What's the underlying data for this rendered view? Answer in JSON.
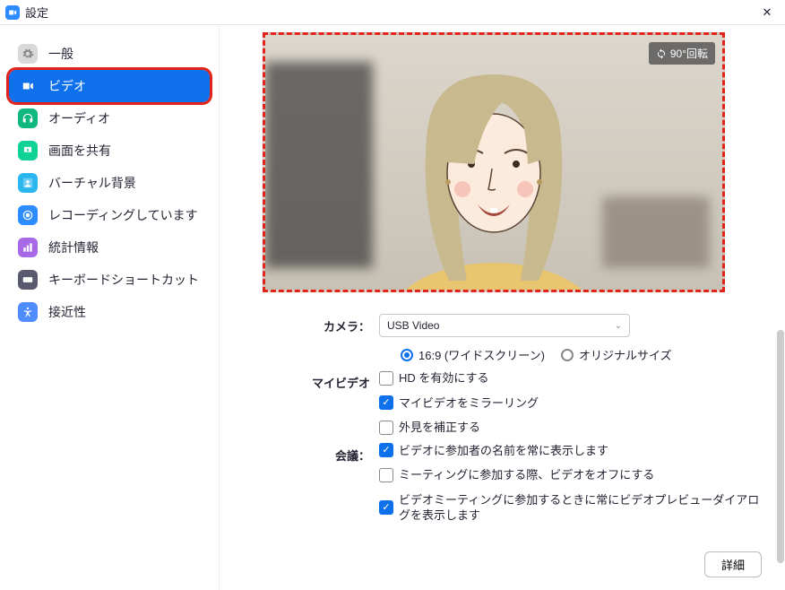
{
  "window": {
    "title": "設定",
    "rotate_label": "90°回転"
  },
  "sidebar": {
    "items": [
      {
        "label": "一般",
        "icon": "gear",
        "icon_bg": "#D9D9D9",
        "icon_fg": "#888",
        "active": false
      },
      {
        "label": "ビデオ",
        "icon": "video",
        "icon_bg": "#FFFFFF",
        "icon_fg": "#0E71EB",
        "active": true,
        "highlighted": true
      },
      {
        "label": "オーディオ",
        "icon": "headphones",
        "icon_bg": "#10B880",
        "icon_fg": "#fff",
        "active": false
      },
      {
        "label": "画面を共有",
        "icon": "share",
        "icon_bg": "#0ED296",
        "icon_fg": "#fff",
        "active": false
      },
      {
        "label": "バーチャル背景",
        "icon": "person-bg",
        "icon_bg": "#2BB6EF",
        "icon_fg": "#fff",
        "active": false
      },
      {
        "label": "レコーディングしています",
        "icon": "record",
        "icon_bg": "#2D8CFF",
        "icon_fg": "#fff",
        "active": false
      },
      {
        "label": "統計情報",
        "icon": "stats",
        "icon_bg": "#A869E6",
        "icon_fg": "#fff",
        "active": false
      },
      {
        "label": "キーボードショートカット",
        "icon": "keyboard",
        "icon_bg": "#5A5A6E",
        "icon_fg": "#fff",
        "active": false
      },
      {
        "label": "接近性",
        "icon": "accessibility",
        "icon_bg": "#4E8CFF",
        "icon_fg": "#fff",
        "active": false
      }
    ]
  },
  "video": {
    "camera_label": "カメラ：",
    "camera_value": "USB Video",
    "aspect": {
      "opt_widescreen": "16:9 (ワイドスクリーン)",
      "opt_original": "オリジナルサイズ",
      "selected": "widescreen"
    },
    "myvideo_label": "マイビデオ",
    "myvideo_options": [
      {
        "label": "HD を有効にする",
        "checked": false
      },
      {
        "label": "マイビデオをミラーリング",
        "checked": true
      },
      {
        "label": "外見を補正する",
        "checked": false
      }
    ],
    "meeting_label": "会議：",
    "meeting_options": [
      {
        "label": "ビデオに参加者の名前を常に表示します",
        "checked": true
      },
      {
        "label": "ミーティングに参加する際、ビデオをオフにする",
        "checked": false
      },
      {
        "label": "ビデオミーティングに参加するときに常にビデオプレビューダイアログを表示します",
        "checked": true
      }
    ]
  },
  "footer": {
    "detail_label": "詳細"
  }
}
